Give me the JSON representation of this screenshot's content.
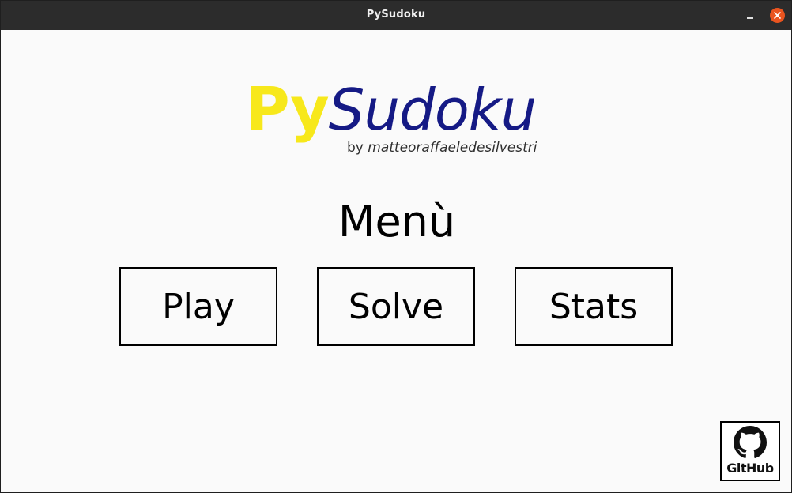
{
  "window": {
    "title": "PySudoku",
    "minimize_icon": "minimize-icon",
    "close_icon": "close-icon"
  },
  "logo": {
    "py": "Py",
    "sudoku": "Sudoku",
    "py_color": "#f7e81b",
    "sudoku_color": "#151a85"
  },
  "byline": {
    "prefix": "by ",
    "author": "matteoraffaeledesilvestri"
  },
  "menu": {
    "title": "Menù",
    "buttons": [
      {
        "label": "Play"
      },
      {
        "label": "Solve"
      },
      {
        "label": "Stats"
      }
    ]
  },
  "github": {
    "label": "GitHub",
    "icon": "github-octocat-icon"
  },
  "colors": {
    "titlebar": "#2c2c2c",
    "background": "#fafafa",
    "close_button": "#e9541f"
  }
}
